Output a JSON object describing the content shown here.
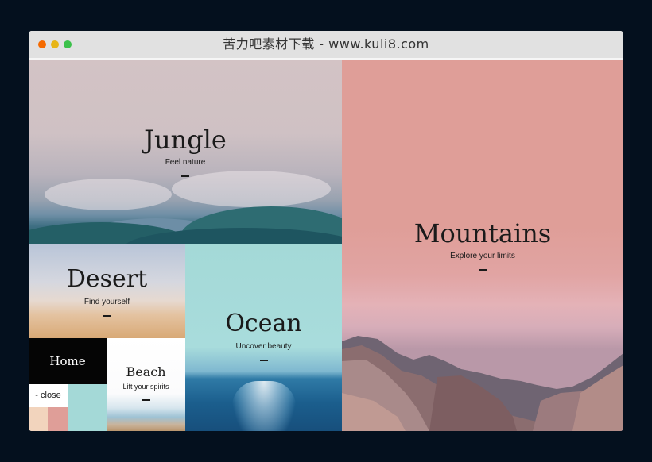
{
  "window": {
    "title": "苦力吧素材下载 - www.kuli8.com"
  },
  "panels": {
    "jungle": {
      "title": "Jungle",
      "subtitle": "Feel nature"
    },
    "mountains": {
      "title": "Mountains",
      "subtitle": "Explore your limits"
    },
    "desert": {
      "title": "Desert",
      "subtitle": "Find yourself"
    },
    "ocean": {
      "title": "Ocean",
      "subtitle": "Uncover beauty"
    },
    "beach": {
      "title": "Beach",
      "subtitle": "Lift your spirits"
    }
  },
  "nav": {
    "home_label": "Home",
    "close_label": "- close",
    "swatches": [
      {
        "name": "desert-swatch",
        "color": "#f2d4bd"
      },
      {
        "name": "mountains-swatch",
        "color": "#df9e98"
      },
      {
        "name": "ocean-swatch",
        "color": "#a4d9d7"
      }
    ]
  },
  "colors": {
    "background": "#04101e",
    "titlebar": "#e1e1e1",
    "mountains": "#df9e98",
    "ocean": "#a4d9d7",
    "home": "#050505"
  }
}
